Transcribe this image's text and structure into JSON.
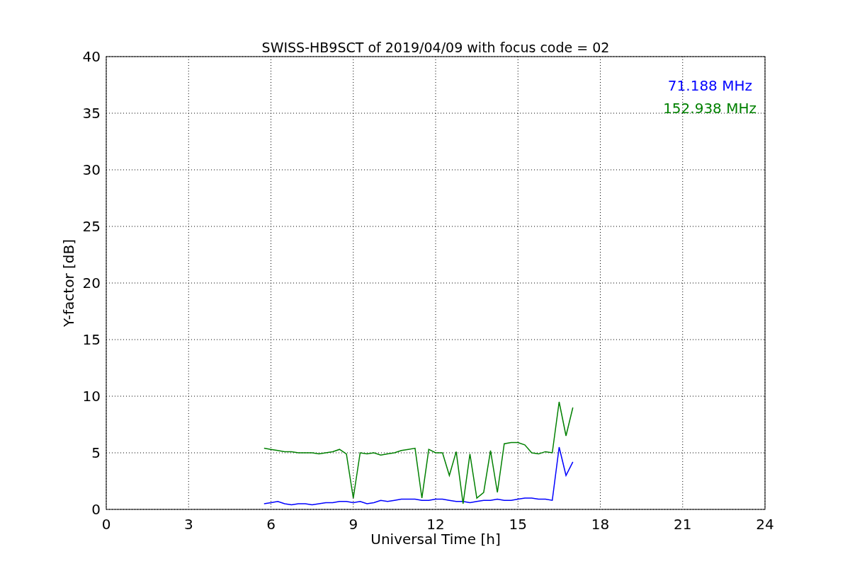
{
  "chart_data": {
    "type": "line",
    "title": "SWISS-HB9SCT of 2019/04/09 with focus code = 02",
    "xlabel": "Universal Time [h]",
    "ylabel": "Y-factor [dB]",
    "x": [
      5.75,
      6,
      6.25,
      6.5,
      6.75,
      7,
      7.25,
      7.5,
      7.75,
      8,
      8.25,
      8.5,
      8.75,
      9,
      9.25,
      9.5,
      9.75,
      10,
      10.25,
      10.5,
      10.75,
      11,
      11.25,
      11.5,
      11.75,
      12,
      12.25,
      12.5,
      12.75,
      13,
      13.25,
      13.5,
      13.75,
      14,
      14.25,
      14.5,
      14.75,
      15,
      15.25,
      15.5,
      15.75,
      16,
      16.25,
      16.5,
      16.75,
      17
    ],
    "series": [
      {
        "name": "71.188 MHz",
        "color": "#0000ff",
        "values": [
          0.5,
          0.6,
          0.7,
          0.5,
          0.4,
          0.5,
          0.5,
          0.4,
          0.5,
          0.6,
          0.6,
          0.7,
          0.7,
          0.6,
          0.7,
          0.5,
          0.6,
          0.8,
          0.7,
          0.8,
          0.9,
          0.9,
          0.9,
          0.8,
          0.8,
          0.9,
          0.9,
          0.8,
          0.7,
          0.7,
          0.6,
          0.7,
          0.8,
          0.8,
          0.9,
          0.8,
          0.8,
          0.9,
          1.0,
          1.0,
          0.9,
          0.9,
          0.8,
          5.5,
          3.0,
          4.2
        ]
      },
      {
        "name": "152.938 MHz",
        "color": "#008000",
        "values": [
          5.4,
          5.3,
          5.2,
          5.1,
          5.1,
          5.0,
          5.0,
          5.0,
          4.9,
          5.0,
          5.1,
          5.3,
          4.9,
          1.0,
          5.0,
          4.9,
          5.0,
          4.8,
          4.9,
          5.0,
          5.2,
          5.3,
          5.4,
          1.0,
          5.3,
          5.0,
          5.0,
          3.0,
          5.1,
          0.5,
          4.9,
          1.0,
          1.5,
          5.2,
          1.5,
          5.8,
          5.9,
          5.9,
          5.7,
          5.0,
          4.9,
          5.1,
          5.0,
          9.5,
          6.5,
          9.0
        ]
      }
    ],
    "xlim": [
      0,
      24
    ],
    "ylim": [
      0,
      40
    ],
    "xticks": [
      0,
      3,
      6,
      9,
      12,
      15,
      18,
      21,
      24
    ],
    "yticks": [
      0,
      5,
      10,
      15,
      20,
      25,
      30,
      35,
      40
    ],
    "grid": true
  }
}
